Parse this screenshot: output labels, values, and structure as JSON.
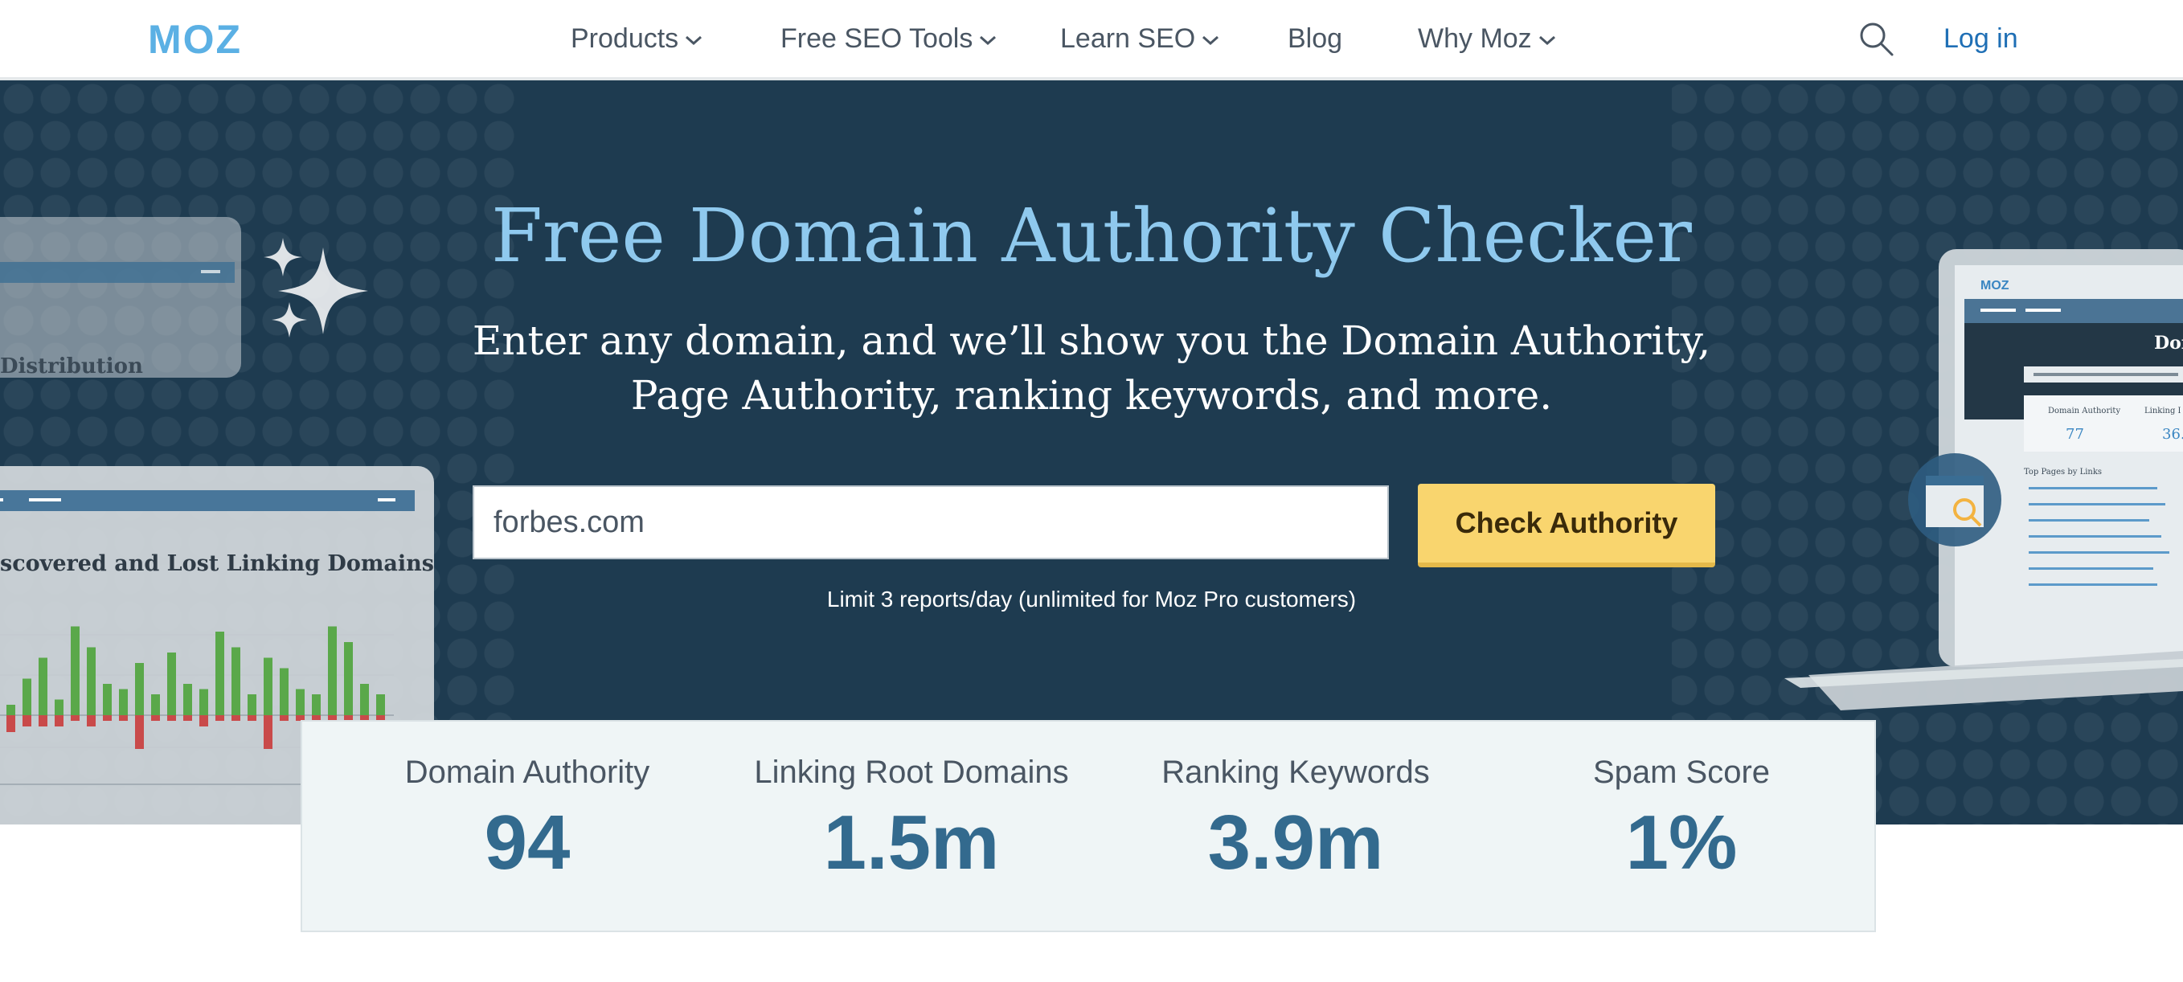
{
  "header": {
    "logo_text": "MOZ",
    "nav": [
      {
        "label": "Products",
        "has_dropdown": true
      },
      {
        "label": "Free SEO Tools",
        "has_dropdown": true
      },
      {
        "label": "Learn SEO",
        "has_dropdown": true
      },
      {
        "label": "Blog",
        "has_dropdown": false
      },
      {
        "label": "Why Moz",
        "has_dropdown": true
      }
    ],
    "search_icon": "search-icon",
    "login_label": "Log in"
  },
  "hero": {
    "title": "Free Domain Authority Checker",
    "subtitle_line1": "Enter any domain, and we’ll show you the Domain Authority,",
    "subtitle_line2": "Page Authority, ranking keywords, and more.",
    "input_value": "forbes.com",
    "button_label": "Check Authority",
    "limit_note": "Limit 3 reports/day (unlimited for Moz Pro customers)"
  },
  "illustration_left": {
    "card_back_title": "Distribution",
    "card_front_title": "scovered and Lost Linking Domains",
    "bars_up": [
      0.1,
      0.35,
      0.55,
      0.15,
      0.85,
      0.65,
      0.3,
      0.25,
      0.5,
      0.2,
      0.6,
      0.3,
      0.25,
      0.8,
      0.65,
      0.2,
      0.55,
      0.45,
      0.25,
      0.2,
      0.85,
      0.7,
      0.3,
      0.2
    ],
    "bars_down": [
      0.15,
      0.1,
      0.1,
      0.1,
      0.05,
      0.1,
      0.05,
      0.05,
      0.3,
      0.05,
      0.05,
      0.05,
      0.1,
      0.05,
      0.05,
      0.05,
      0.3,
      0.05,
      0.05,
      0.05,
      0.05,
      0.05,
      0.1,
      0.1
    ]
  },
  "illustration_right": {
    "logo_text": "MOZ",
    "heading_fragment": "Dom",
    "metric1_label": "Domain Authority",
    "metric1_value": "77",
    "metric2_label": "Linking I",
    "metric2_value": "36.",
    "list_title": "Top Pages by Links"
  },
  "stats": [
    {
      "label": "Domain Authority",
      "value": "94"
    },
    {
      "label": "Linking Root Domains",
      "value": "1.5m"
    },
    {
      "label": "Ranking Keywords",
      "value": "3.9m"
    },
    {
      "label": "Spam Score",
      "value": "1%"
    }
  ],
  "colors": {
    "hero_bg": "#1e3b50",
    "title": "#8fc9ee",
    "button": "#f9d56e",
    "stat_value": "#336a8e",
    "link": "#1f6fb5",
    "logo": "#5bb0e4"
  }
}
